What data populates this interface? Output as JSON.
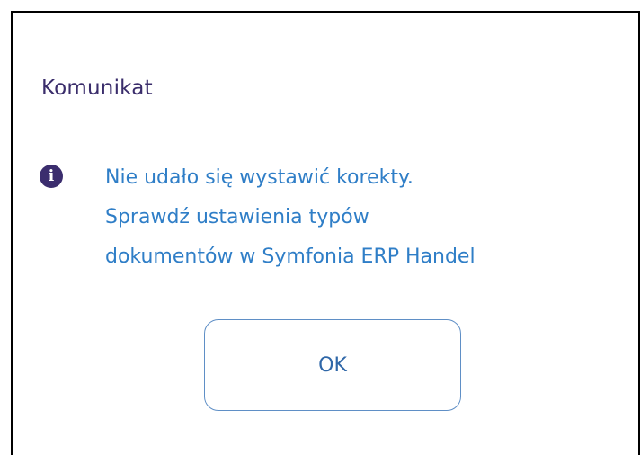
{
  "dialog": {
    "title": "Komunikat",
    "icon": "info-icon",
    "message_lines": [
      "Nie udało się wystawić korekty.",
      "Sprawdź ustawienia typów",
      "dokumentów w Symfonia ERP Handel"
    ],
    "ok_label": "OK"
  },
  "colors": {
    "title": "#3a2d6b",
    "message": "#2f7ec7",
    "icon_bg": "#3b2d6e",
    "button_border": "#5f8fc6",
    "button_text": "#2f67a8"
  }
}
